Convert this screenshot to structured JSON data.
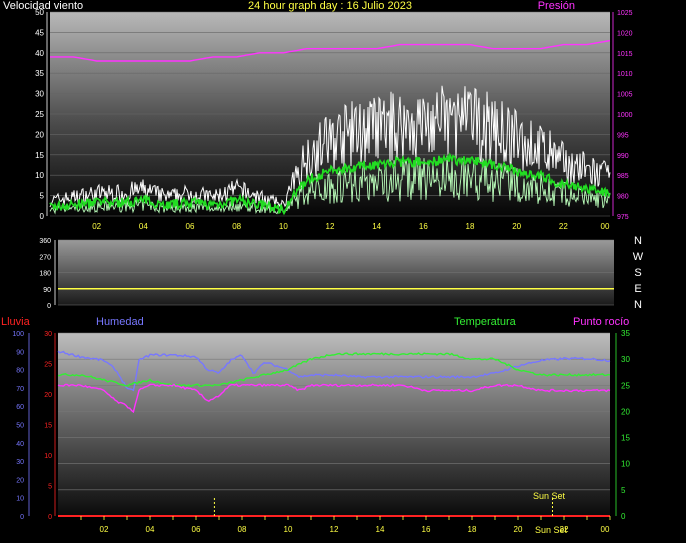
{
  "header": {
    "title": "24 hour graph day : 16 Julio 2023",
    "wind_label": "Velocidad viento",
    "pressure_label": "Presión"
  },
  "middle": {
    "direction_labels": [
      "N",
      "W",
      "S",
      "E",
      "N"
    ]
  },
  "bottom": {
    "rain_label": "Lluvia",
    "humidity_label": "Humedad",
    "temperature_label": "Temperatura",
    "dewpoint_label": "Punto rocío",
    "sunset_label": "Sun Set",
    "sunset_label_axis": "Sun Set"
  },
  "colors": {
    "wind_speed": "#ffffff",
    "wind_avg": "#22dd22",
    "wind_low": "#bbffbb",
    "pressure": "#ff33ff",
    "direction": "#ffff44",
    "humidity": "#7777ff",
    "temperature": "#33ee33",
    "dewpoint": "#ff33ff",
    "rain": "#ff2222",
    "hour_ticks": "#ffff44"
  },
  "chart_data": [
    {
      "name": "wind-pressure",
      "type": "line",
      "title": "24 hour graph day : 16 Julio 2023",
      "x_ticks": [
        "02",
        "04",
        "06",
        "08",
        "10",
        "12",
        "14",
        "16",
        "18",
        "20",
        "22",
        "00"
      ],
      "ylim_left": [
        0,
        50
      ],
      "y_ticks_left": [
        0,
        5,
        10,
        15,
        20,
        25,
        30,
        35,
        40,
        45,
        50
      ],
      "ylim_right": [
        975,
        1025
      ],
      "y_ticks_right": [
        975,
        980,
        985,
        990,
        995,
        1000,
        1005,
        1010,
        1015,
        1020,
        1025
      ],
      "series": [
        {
          "name": "Velocidad viento",
          "axis": "left",
          "x": [
            0,
            1,
            2,
            3,
            4,
            5,
            6,
            7,
            8,
            9,
            10,
            11,
            12,
            13,
            14,
            15,
            16,
            17,
            18,
            19,
            20,
            21,
            22,
            23,
            24
          ],
          "values": [
            4,
            5,
            6,
            6,
            7,
            5,
            6,
            5,
            7,
            5,
            3,
            16,
            20,
            22,
            23,
            24,
            24,
            25,
            25,
            23,
            20,
            18,
            14,
            12,
            10
          ]
        },
        {
          "name": "Presión",
          "axis": "right",
          "x": [
            0,
            1,
            2,
            3,
            4,
            5,
            6,
            7,
            8,
            9,
            10,
            11,
            12,
            13,
            14,
            15,
            16,
            17,
            18,
            19,
            20,
            21,
            22,
            23,
            24
          ],
          "values": [
            1014,
            1014,
            1013,
            1013,
            1013,
            1013,
            1013,
            1014,
            1014,
            1015,
            1015,
            1016,
            1016,
            1016,
            1016,
            1017,
            1017,
            1017,
            1017,
            1016,
            1016,
            1016,
            1017,
            1017,
            1018
          ]
        }
      ]
    },
    {
      "name": "wind-direction",
      "type": "line",
      "x_ticks": [
        "02",
        "04",
        "06",
        "08",
        "10",
        "12",
        "14",
        "16",
        "18",
        "20",
        "22",
        "00"
      ],
      "ylim": [
        0,
        360
      ],
      "y_ticks": [
        0,
        90,
        180,
        270,
        360
      ],
      "series": [
        {
          "axis": "left",
          "x": [
            0,
            24
          ],
          "values": [
            90,
            90
          ]
        }
      ]
    },
    {
      "name": "humidity-temperature",
      "type": "line",
      "x_ticks": [
        "02",
        "04",
        "06",
        "08",
        "10",
        "12",
        "14",
        "16",
        "18",
        "20",
        "22",
        "00"
      ],
      "ylim_humidity": [
        0,
        100
      ],
      "y_ticks_humidity": [
        0,
        10,
        20,
        30,
        40,
        50,
        60,
        70,
        80,
        90,
        100
      ],
      "ylim_rain": [
        0,
        30
      ],
      "y_ticks_rain": [
        0,
        5,
        10,
        15,
        20,
        25,
        30
      ],
      "ylim_temp": [
        0,
        35
      ],
      "y_ticks_temp": [
        0,
        5,
        10,
        15,
        20,
        25,
        30,
        35
      ],
      "sunset_hour": 21.5,
      "series": [
        {
          "name": "Humedad",
          "axis": "humidity",
          "x": [
            0,
            1,
            2,
            2.5,
            3,
            3.3,
            3.5,
            4,
            5,
            6,
            6.5,
            7,
            7.5,
            8,
            8.5,
            9,
            9.5,
            10,
            10.5,
            11,
            12,
            13,
            14,
            15,
            16,
            17,
            18,
            19,
            20,
            21,
            22,
            23,
            24
          ],
          "values": [
            90,
            87,
            85,
            80,
            70,
            68,
            85,
            88,
            88,
            87,
            80,
            78,
            85,
            88,
            78,
            84,
            82,
            80,
            76,
            77,
            77,
            76,
            76,
            76,
            76,
            76,
            76,
            78,
            82,
            85,
            86,
            86,
            85
          ]
        },
        {
          "name": "Temperatura",
          "axis": "temp",
          "x": [
            0,
            1,
            2,
            3,
            4,
            5,
            6,
            7,
            8,
            9,
            10,
            11,
            12,
            13,
            14,
            15,
            16,
            17,
            18,
            19,
            20,
            21,
            22,
            23,
            24
          ],
          "values": [
            27,
            27,
            26,
            25,
            26,
            25,
            25,
            25,
            26,
            27,
            28,
            30,
            31,
            31,
            31,
            31,
            31,
            31,
            30,
            30,
            28,
            27,
            27,
            27,
            27
          ]
        },
        {
          "name": "Punto rocío",
          "axis": "temp",
          "x": [
            0,
            1,
            2,
            2.5,
            3,
            3.3,
            3.5,
            4,
            5,
            6,
            6.5,
            7,
            7.5,
            8,
            9,
            10,
            10.5,
            11,
            12,
            13,
            14,
            15,
            16,
            17,
            18,
            19,
            20,
            21,
            22,
            23,
            24
          ],
          "values": [
            25,
            25,
            24,
            22,
            21,
            20,
            24,
            25,
            25,
            24,
            22,
            23,
            25,
            25,
            25,
            25,
            24,
            25,
            25,
            25,
            25,
            25,
            24,
            24,
            24,
            25,
            25,
            24,
            24,
            24,
            24
          ]
        },
        {
          "name": "Lluvia",
          "axis": "rain",
          "x": [
            0,
            24
          ],
          "values": [
            0,
            0
          ]
        }
      ]
    }
  ]
}
